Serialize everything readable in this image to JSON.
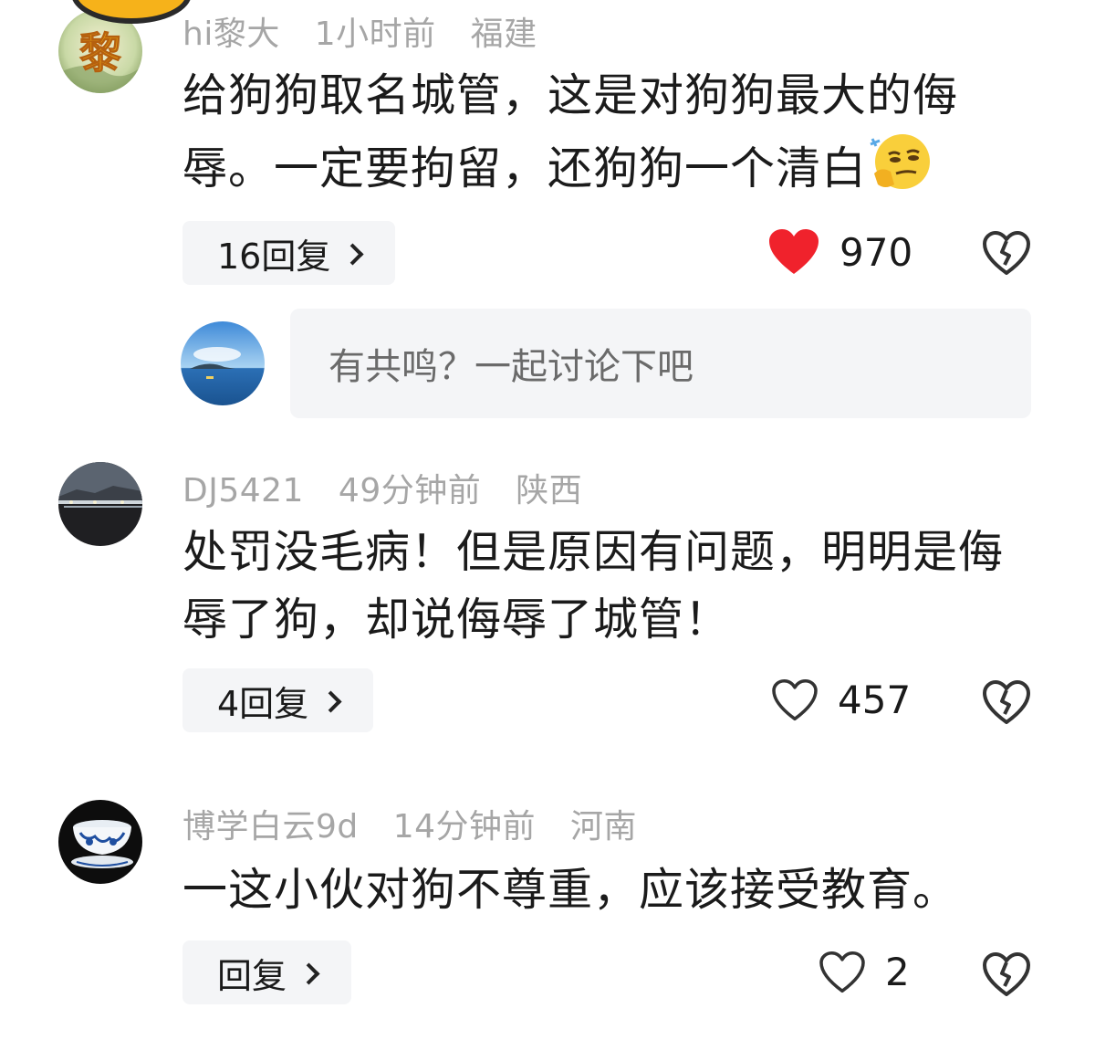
{
  "comments": [
    {
      "username": "hi黎大",
      "time": "1小时前",
      "location": "福建",
      "text": "给狗狗取名城管，这是对狗狗最大的侮辱。一定要拘留，还狗狗一个清白",
      "emoji": "smirk-thinking-emoji",
      "reply_label": "16回复",
      "likes": "970",
      "liked": true,
      "avatar_char": "黎"
    },
    {
      "username": "DJ5421",
      "time": "49分钟前",
      "location": "陕西",
      "text": "处罚没毛病！但是原因有问题，明明是侮辱了狗，却说侮辱了城管！",
      "reply_label": "4回复",
      "likes": "457",
      "liked": false
    },
    {
      "username": "博学白云9d",
      "time": "14分钟前",
      "location": "河南",
      "text": "一这小伙对狗不尊重，应该接受教育。",
      "reply_label": "回复",
      "likes": "2",
      "liked": false
    }
  ],
  "reply_box": {
    "placeholder": "有共鸣？一起讨论下吧"
  },
  "colors": {
    "like_red": "#f0222c",
    "meta_gray": "#a6a6a6",
    "pill_bg": "#f4f5f7"
  }
}
